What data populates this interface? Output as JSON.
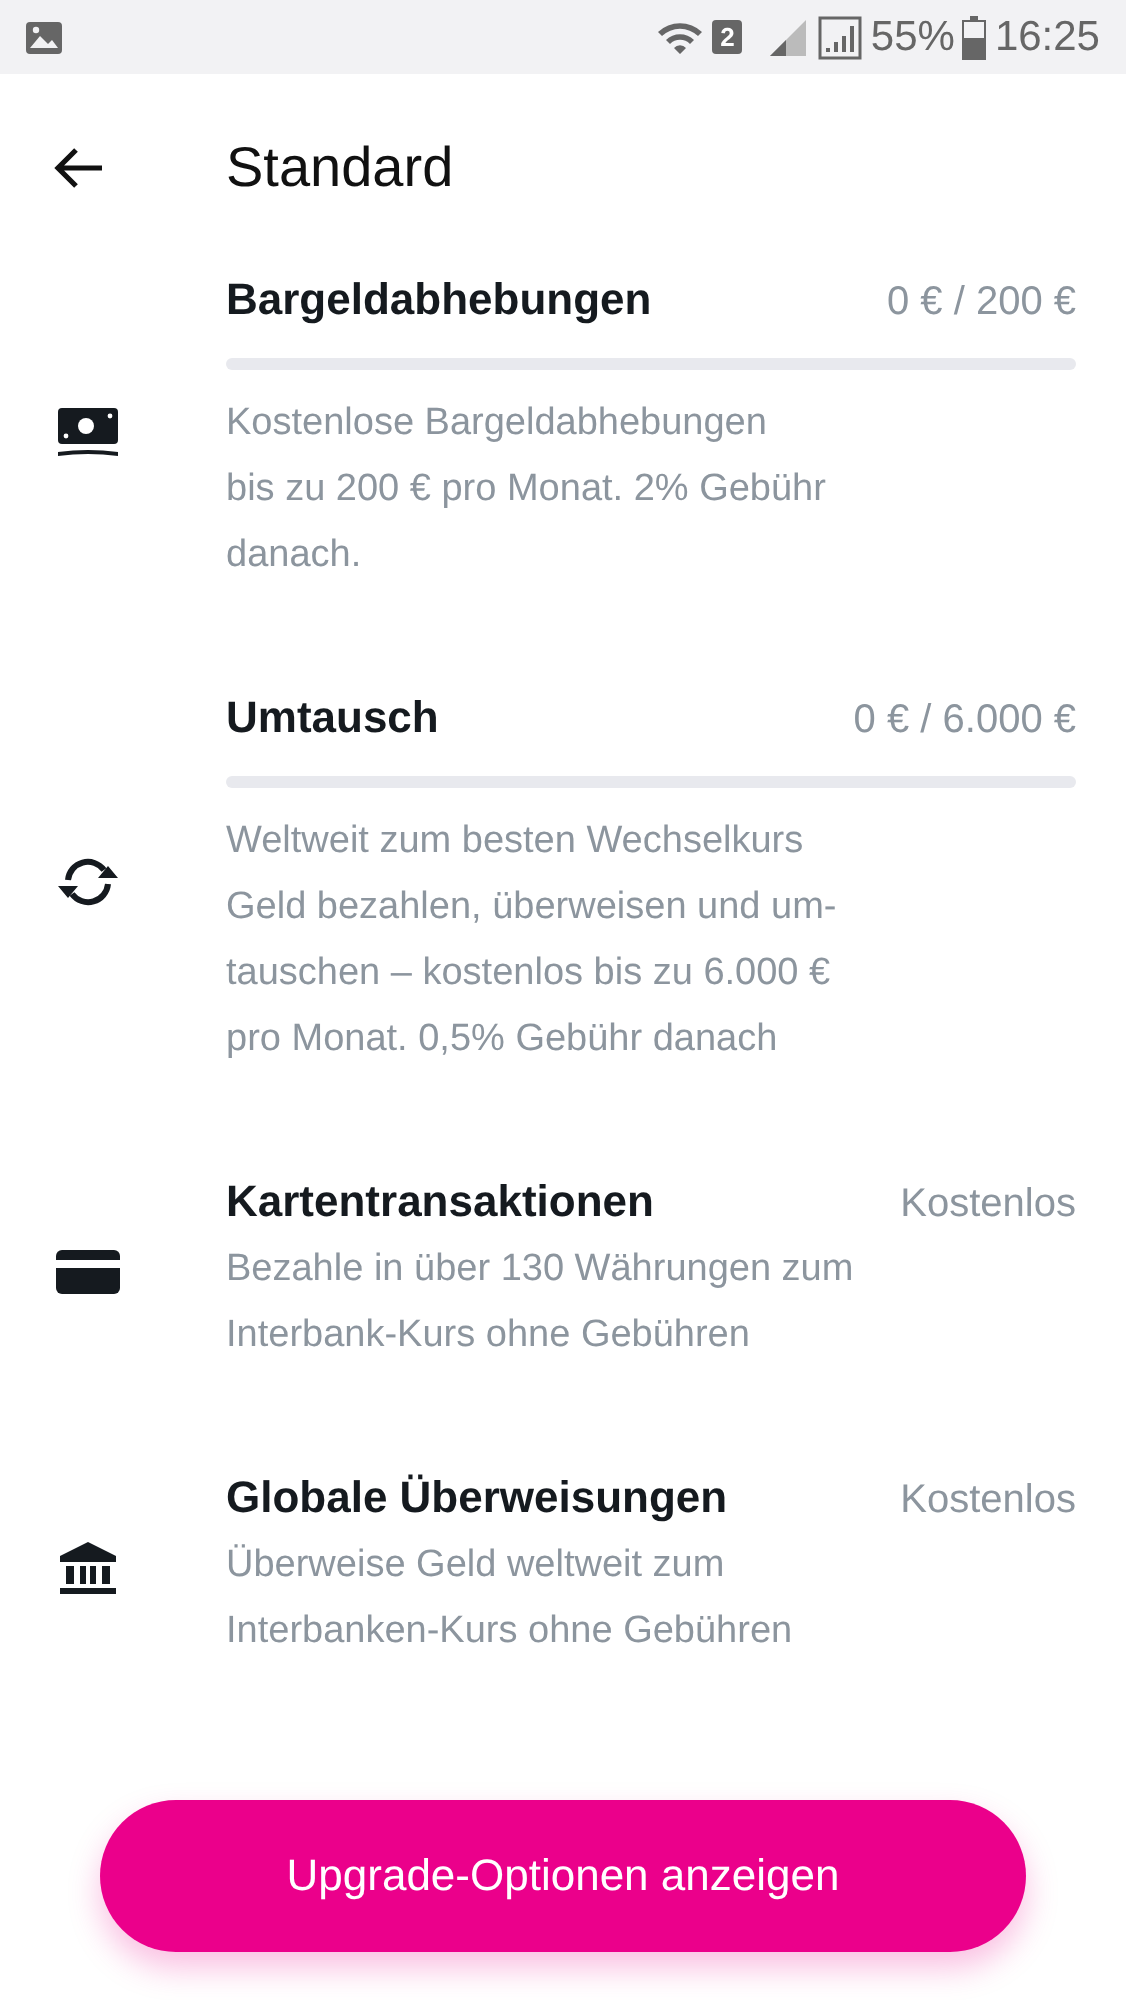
{
  "status_bar": {
    "battery": "55%",
    "time": "16:25",
    "sim": "2"
  },
  "header": {
    "title": "Standard"
  },
  "sections": [
    {
      "kind": "limit",
      "title": "Bargeldabhebungen",
      "value": "0 € / 200 €",
      "level": 0,
      "description_lines": [
        "Kostenlose Bargeldabhebungen",
        "bis zu 200 € pro Monat. 2% Gebühr",
        "danach."
      ]
    },
    {
      "kind": "limit",
      "title": "Umtausch",
      "value": "0 € / 6.000 €",
      "level": 0,
      "description_lines": [
        "Weltweit zum besten Wechselkurs",
        "Geld bezahlen, überweisen und um-",
        "tauschen – kostenlos bis zu 6.000 €",
        "pro Monat. 0,5% Gebühr danach"
      ]
    },
    {
      "kind": "free",
      "title": "Kartentransaktionen",
      "value": "Kostenlos",
      "description_lines": [
        "Bezahle in über 130 Währungen zum",
        "Interbank-Kurs ohne Gebühren"
      ]
    },
    {
      "kind": "free",
      "title": "Globale Überweisungen",
      "value": "Kostenlos",
      "description_lines": [
        "Überweise Geld weltweit zum",
        "Interbanken-Kurs ohne Gebühren"
      ]
    }
  ],
  "button": {
    "label": "Upgrade-Optionen anzeigen"
  }
}
